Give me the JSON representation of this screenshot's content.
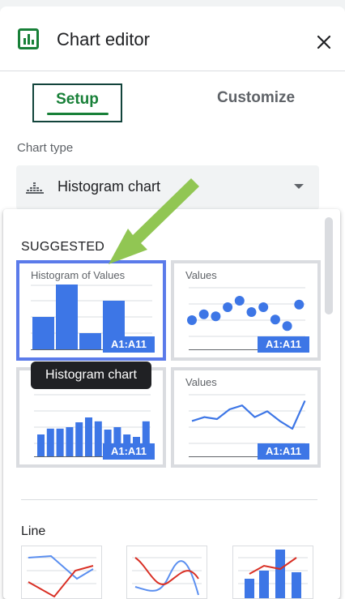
{
  "header": {
    "title": "Chart editor",
    "logo_icon": "chart-editor-icon",
    "close_icon": "close-icon"
  },
  "tabs": [
    {
      "label": "Setup",
      "active": true
    },
    {
      "label": "Customize",
      "active": false
    }
  ],
  "chart_type": {
    "label": "Chart type",
    "value": "Histogram chart",
    "icon": "histogram-icon"
  },
  "dropdown": {
    "sections": [
      {
        "title": "SUGGESTED",
        "cards": [
          {
            "title": "Histogram of Values",
            "range": "A1:A11",
            "kind": "histogram",
            "selected": true,
            "values": [
              0.5,
              1.0,
              0.25,
              0.75
            ]
          },
          {
            "title": "Values",
            "range": "A1:A11",
            "kind": "scatter",
            "selected": false,
            "values": [
              0.2,
              0.38,
              0.32,
              0.6,
              0.8,
              0.45,
              0.6,
              0.22,
              0.02,
              0.68
            ]
          },
          {
            "title": "",
            "range": "A1:A11",
            "kind": "column",
            "selected": false,
            "values": [
              0.45,
              0.57,
              0.57,
              0.6,
              0.7,
              0.8,
              0.72,
              0.55,
              0.6,
              0.45,
              0.4,
              0.72
            ]
          },
          {
            "title": "Values",
            "range": "A1:A11",
            "kind": "line",
            "selected": false,
            "values": [
              0.2,
              0.3,
              0.25,
              0.5,
              0.6,
              0.3,
              0.45,
              0.2,
              0.0,
              0.72
            ]
          }
        ],
        "tooltip": "Histogram chart"
      },
      {
        "title": "Line"
      }
    ]
  },
  "colors": {
    "accent_green": "#188038",
    "series_blue": "#3d76e6",
    "series_red": "#d93025",
    "selected_border": "#5b7bea",
    "annotation_arrow": "#8bc34a"
  }
}
